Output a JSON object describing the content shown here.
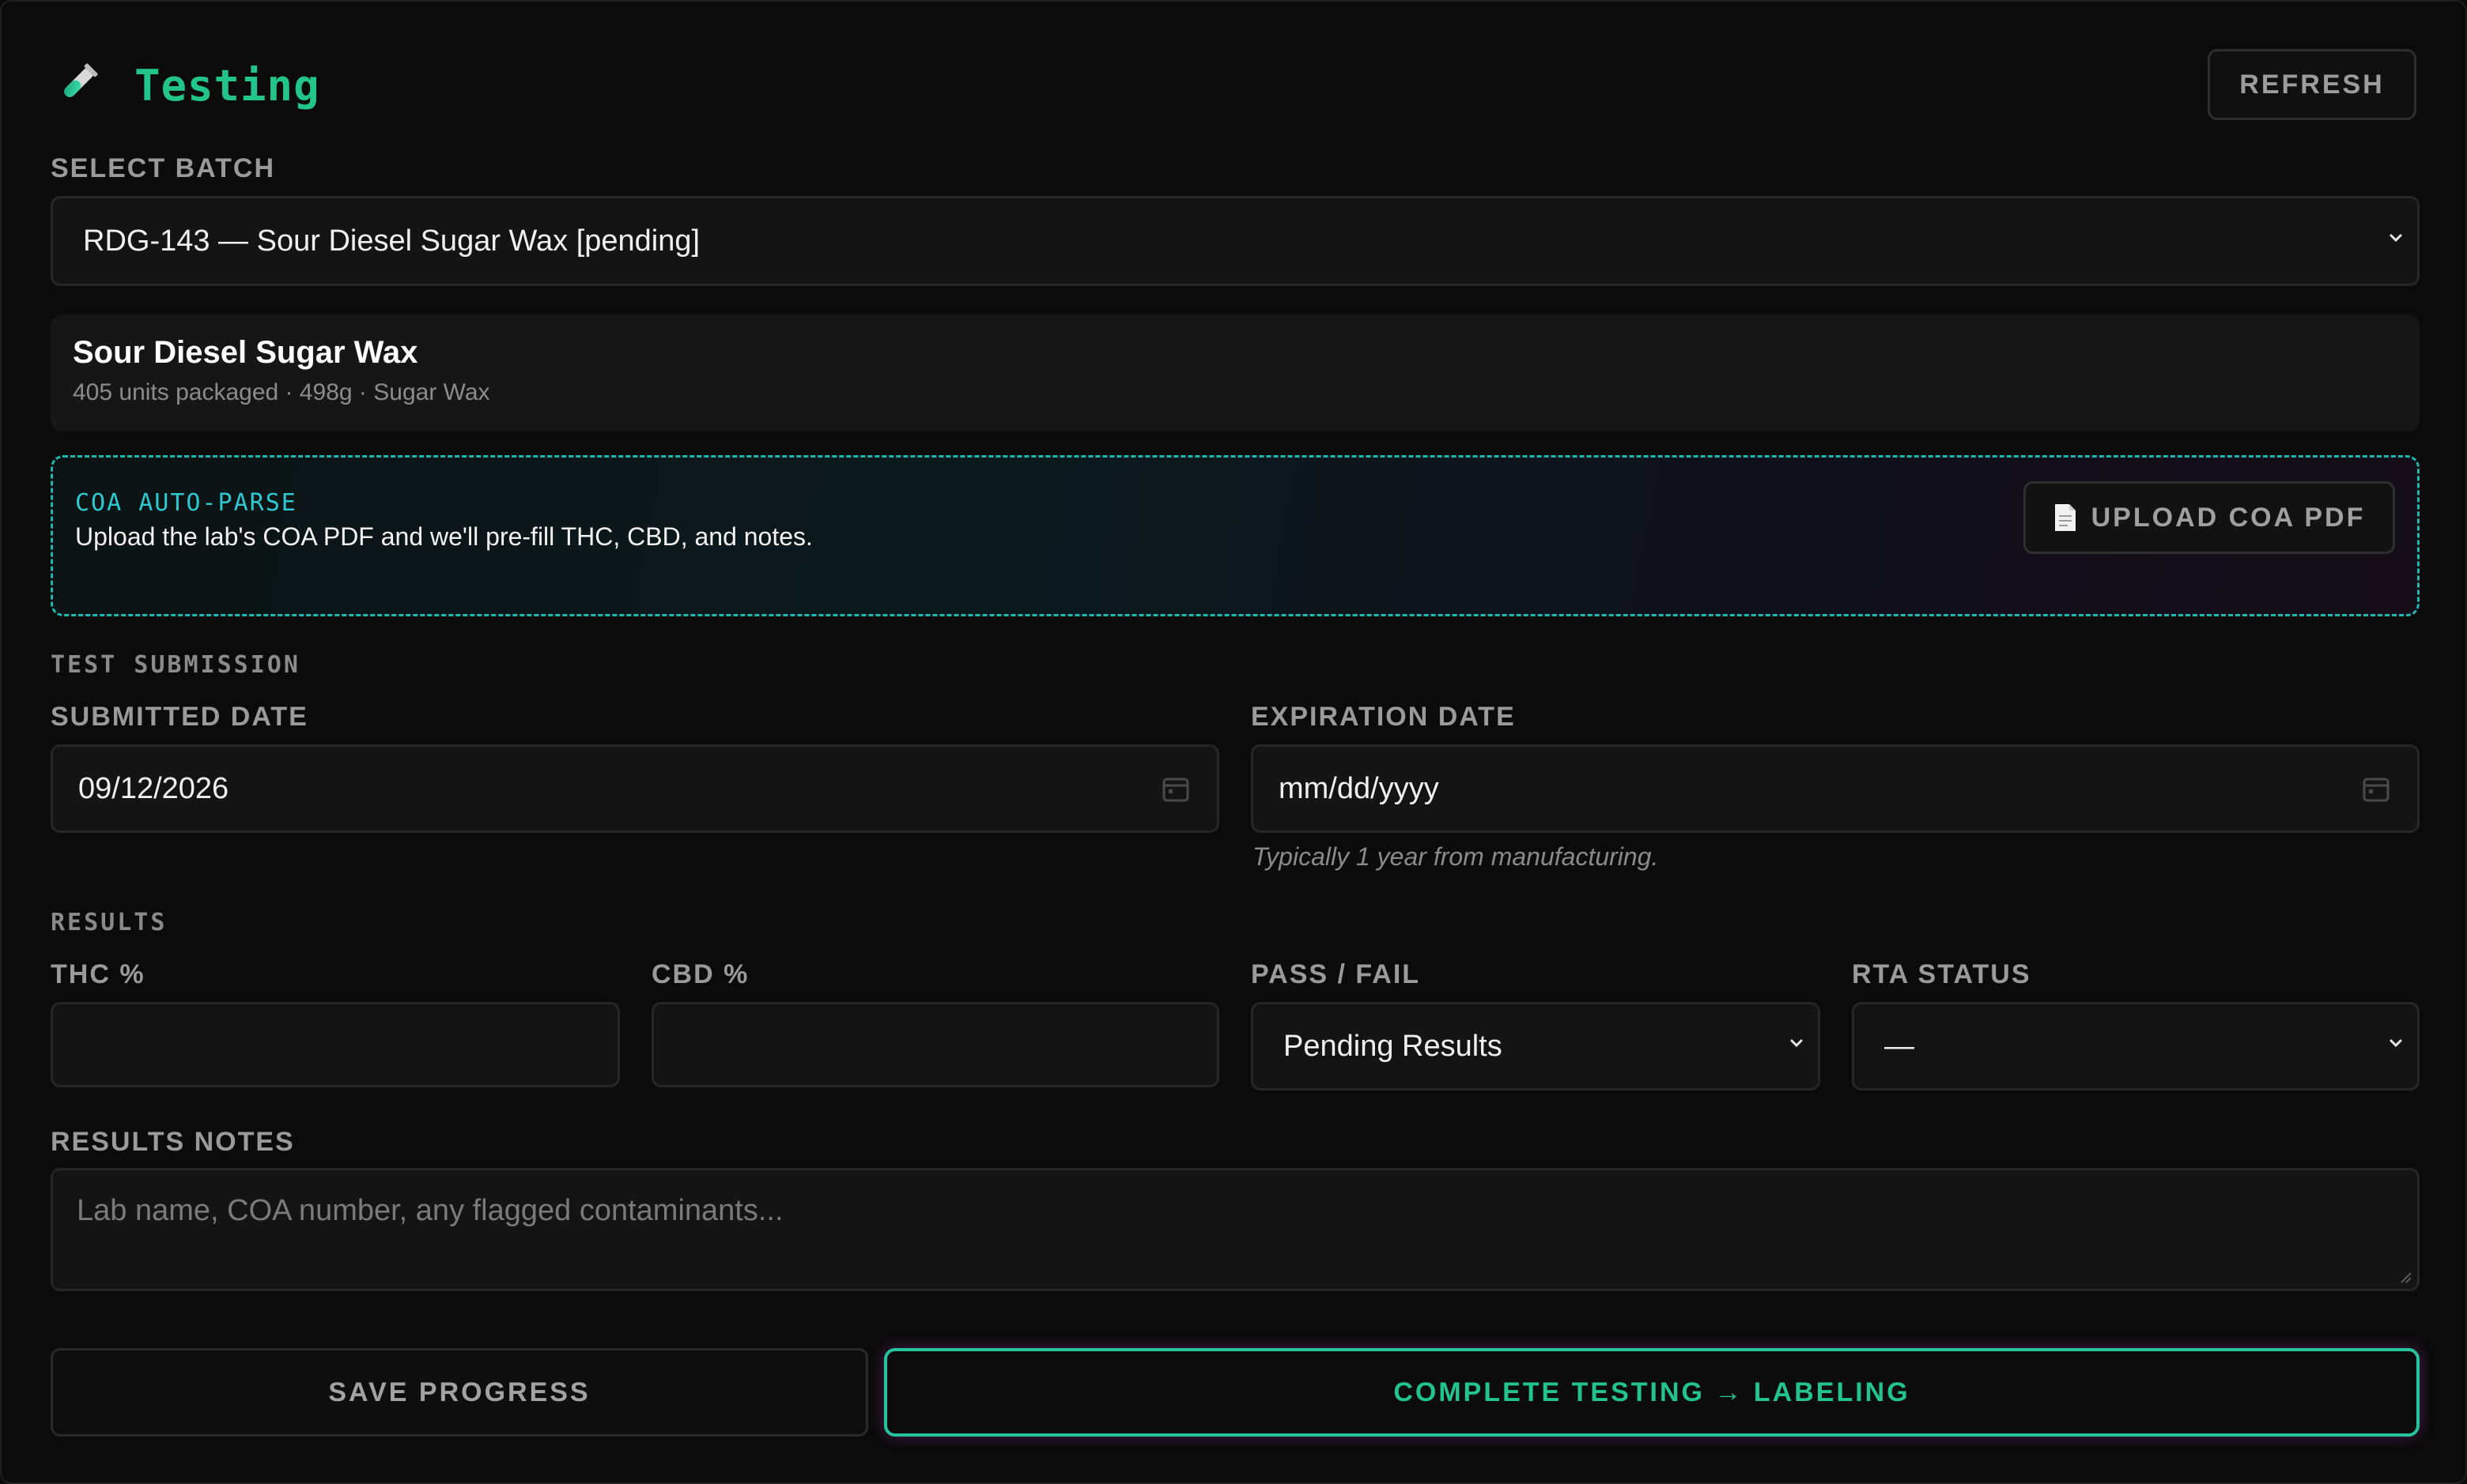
{
  "header": {
    "title": "Testing",
    "icon": "test-tube-icon",
    "refresh_label": "REFRESH"
  },
  "batch": {
    "label": "SELECT BATCH",
    "selected": "RDG-143 — Sour Diesel Sugar Wax [pending]"
  },
  "batch_info": {
    "name": "Sour Diesel Sugar Wax",
    "meta": "405 units packaged · 498g · Sugar Wax"
  },
  "coa": {
    "label": "COA AUTO-PARSE",
    "description": "Upload the lab's COA PDF and we'll pre-fill THC, CBD, and notes.",
    "upload_label": "UPLOAD COA PDF",
    "upload_icon": "document-icon"
  },
  "submission": {
    "section_label": "TEST SUBMISSION",
    "submitted_label": "SUBMITTED DATE",
    "submitted_value": "09/12/2026",
    "expiration_label": "EXPIRATION DATE",
    "expiration_placeholder": "mm/dd/yyyy",
    "expiration_hint": "Typically 1 year from manufacturing."
  },
  "results": {
    "section_label": "RESULTS",
    "thc_label": "THC %",
    "thc_value": "",
    "cbd_label": "CBD %",
    "cbd_value": "",
    "pass_fail_label": "PASS / FAIL",
    "pass_fail_value": "Pending Results",
    "rta_label": "RTA STATUS",
    "rta_value": "—",
    "notes_label": "RESULTS NOTES",
    "notes_placeholder": "Lab name, COA number, any flagged contaminants..."
  },
  "actions": {
    "save_label": "SAVE PROGRESS",
    "complete_label": "COMPLETE TESTING → LABELING"
  },
  "colors": {
    "accent_green": "#23c48b",
    "accent_cyan": "#2ec9d0",
    "background": "#0b0b0b"
  }
}
